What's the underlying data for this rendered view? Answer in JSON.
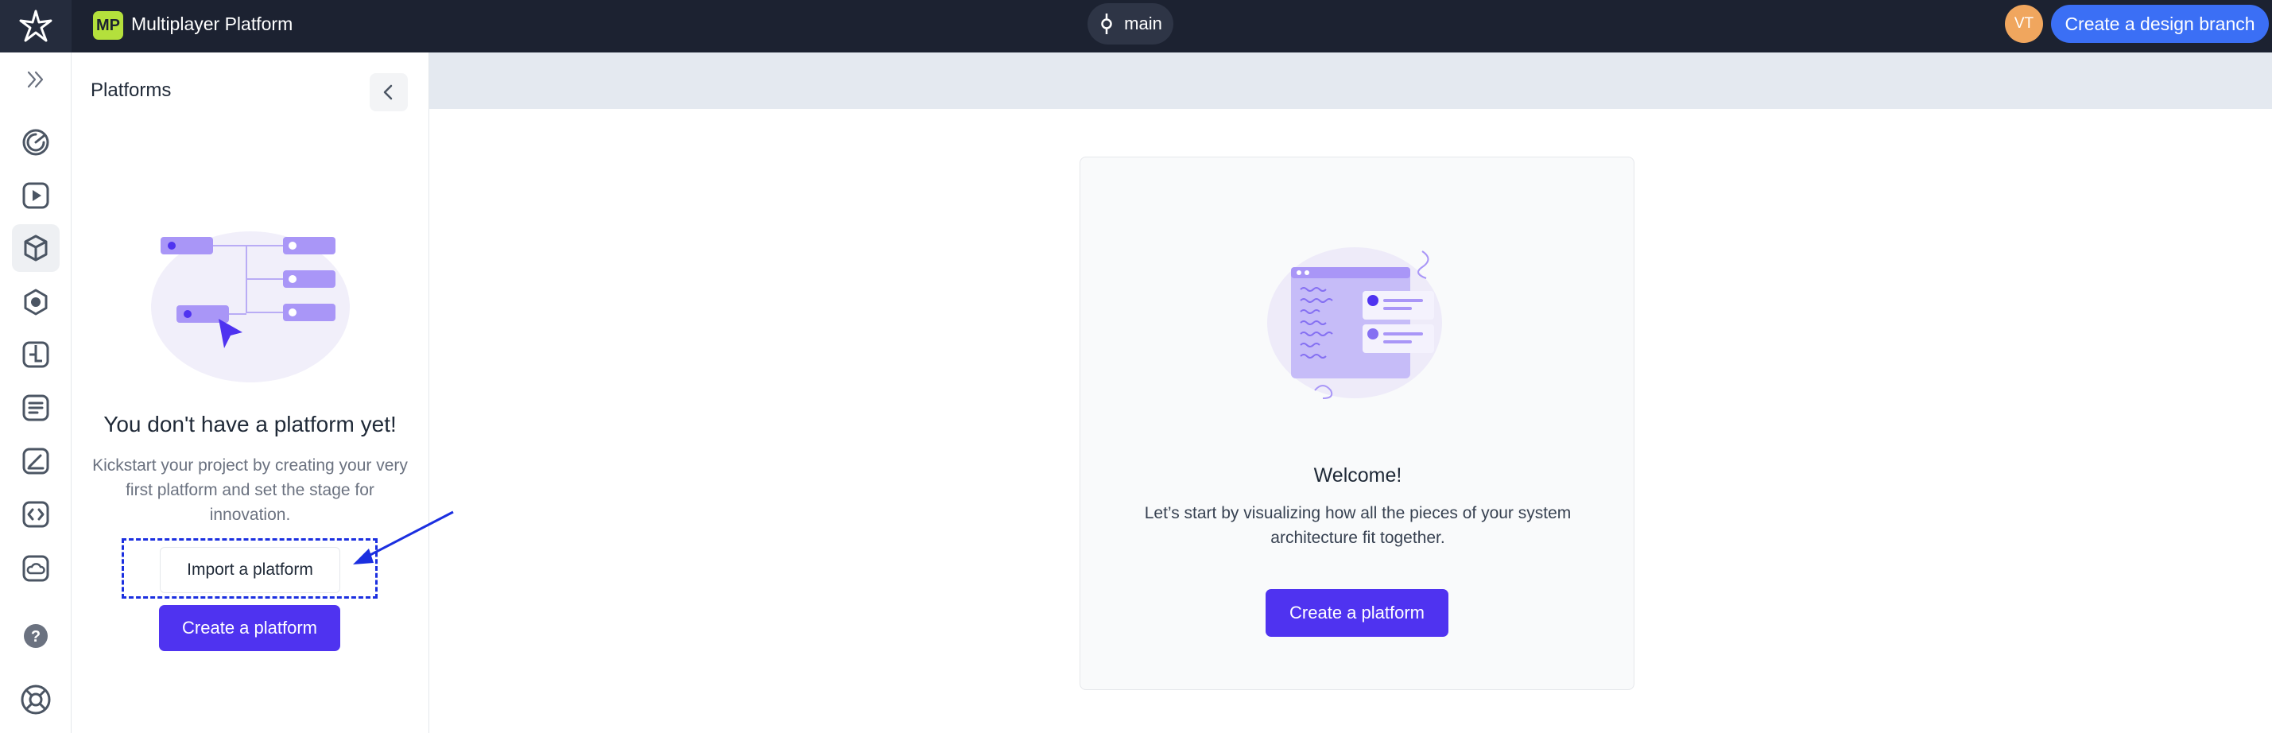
{
  "topbar": {
    "project_badge": "MP",
    "project_name": "Multiplayer Platform",
    "branch_name": "main",
    "avatar_initials": "VT",
    "create_design_branch_label": "Create a design branch"
  },
  "rail": {
    "icons": [
      "expand-icon",
      "dashboard-icon",
      "play-icon",
      "cube-icon",
      "hexagon-icon",
      "layout-icon",
      "document-icon",
      "sketch-icon",
      "code-icon",
      "cloud-icon",
      "help-icon",
      "support-icon"
    ],
    "active": "cube-icon"
  },
  "panel": {
    "title": "Platforms",
    "empty_title": "You don't have a platform yet!",
    "empty_description": "Kickstart your project by creating your very first platform and set the stage for innovation.",
    "import_label": "Import a platform",
    "create_label": "Create a platform"
  },
  "welcome": {
    "title": "Welcome!",
    "description": "Let’s start by visualizing how all the pieces of your system architecture fit together.",
    "create_label": "Create a platform"
  },
  "colors": {
    "topbar": "#1c2231",
    "primary": "#4f33f0",
    "design_branch": "#3b6ff5",
    "avatar": "#f0a65e",
    "badge": "#b4e03c",
    "annotation": "#1b2fe0"
  }
}
